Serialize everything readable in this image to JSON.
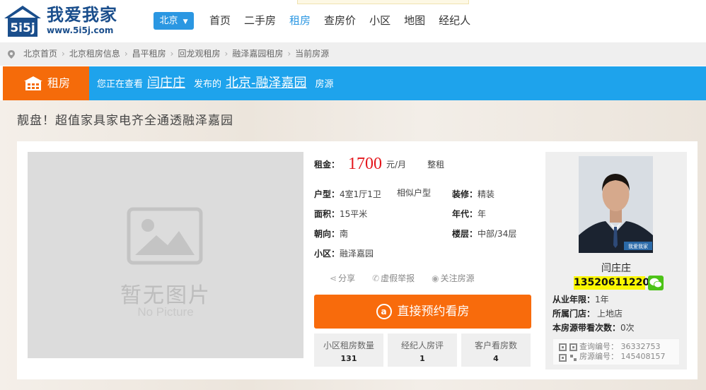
{
  "header": {
    "logo_cn": "我爱我家",
    "logo_url": "www.5i5j.com",
    "logo_mark": "5i5j",
    "city": "北京",
    "nav": [
      "首页",
      "二手房",
      "租房",
      "查房价",
      "小区",
      "地图",
      "经纪人"
    ],
    "active_nav": "租房"
  },
  "breadcrumb": [
    "北京首页",
    "北京租房信息",
    "昌平租房",
    "回龙观租房",
    "融泽嘉园租房",
    "当前房源"
  ],
  "bluebar": {
    "tag": "租房",
    "prefix": "您正在查看",
    "agent_link": "闫庄庄",
    "mid": "发布的",
    "house_link": "北京-融泽嘉园",
    "suffix": "房源"
  },
  "headline": "靓盘！超值家具家电齐全通透融泽嘉园",
  "picture": {
    "cn": "暂无图片",
    "en": "No Picture"
  },
  "listing": {
    "rent_label": "租金：",
    "rent": "1700",
    "rent_unit": "元/月",
    "rent_type": "整租",
    "layout_label": "户型：",
    "layout": "4室1厅1卫",
    "similar": "相似户型",
    "decor_label": "装修：",
    "decor": "精装",
    "area_label": "面积：",
    "area": "15平米",
    "year_label": "年代：",
    "year": "年",
    "facing_label": "朝向：",
    "facing": "南",
    "floor_label": "楼层：",
    "floor": "中部/34层",
    "community_label": "小区：",
    "community": "融泽嘉园"
  },
  "actions": {
    "share": "分享",
    "report": "虚假举报",
    "follow": "关注房源",
    "book": "直接预约看房"
  },
  "stats": [
    {
      "label": "小区租房数量",
      "value": "131"
    },
    {
      "label": "经纪人房评",
      "value": "1"
    },
    {
      "label": "客户看房数",
      "value": "4"
    }
  ],
  "agent": {
    "name": "闫庄庄",
    "phone": "13520611220",
    "years_label": "从业年限：",
    "years": "1年",
    "store_label": "所属门店：",
    "store": "上地店",
    "visits_label": "本房源带看次数：",
    "visits": "0次",
    "query_code": "查询编号： 36332753",
    "house_code": "房源编号： 145408157",
    "photo_badge": "我爱我家"
  },
  "colors": {
    "brand_blue": "#1ea3ec",
    "orange": "#f86b0c",
    "price_red": "#e4151b",
    "logo_navy": "#1a4e8c"
  }
}
